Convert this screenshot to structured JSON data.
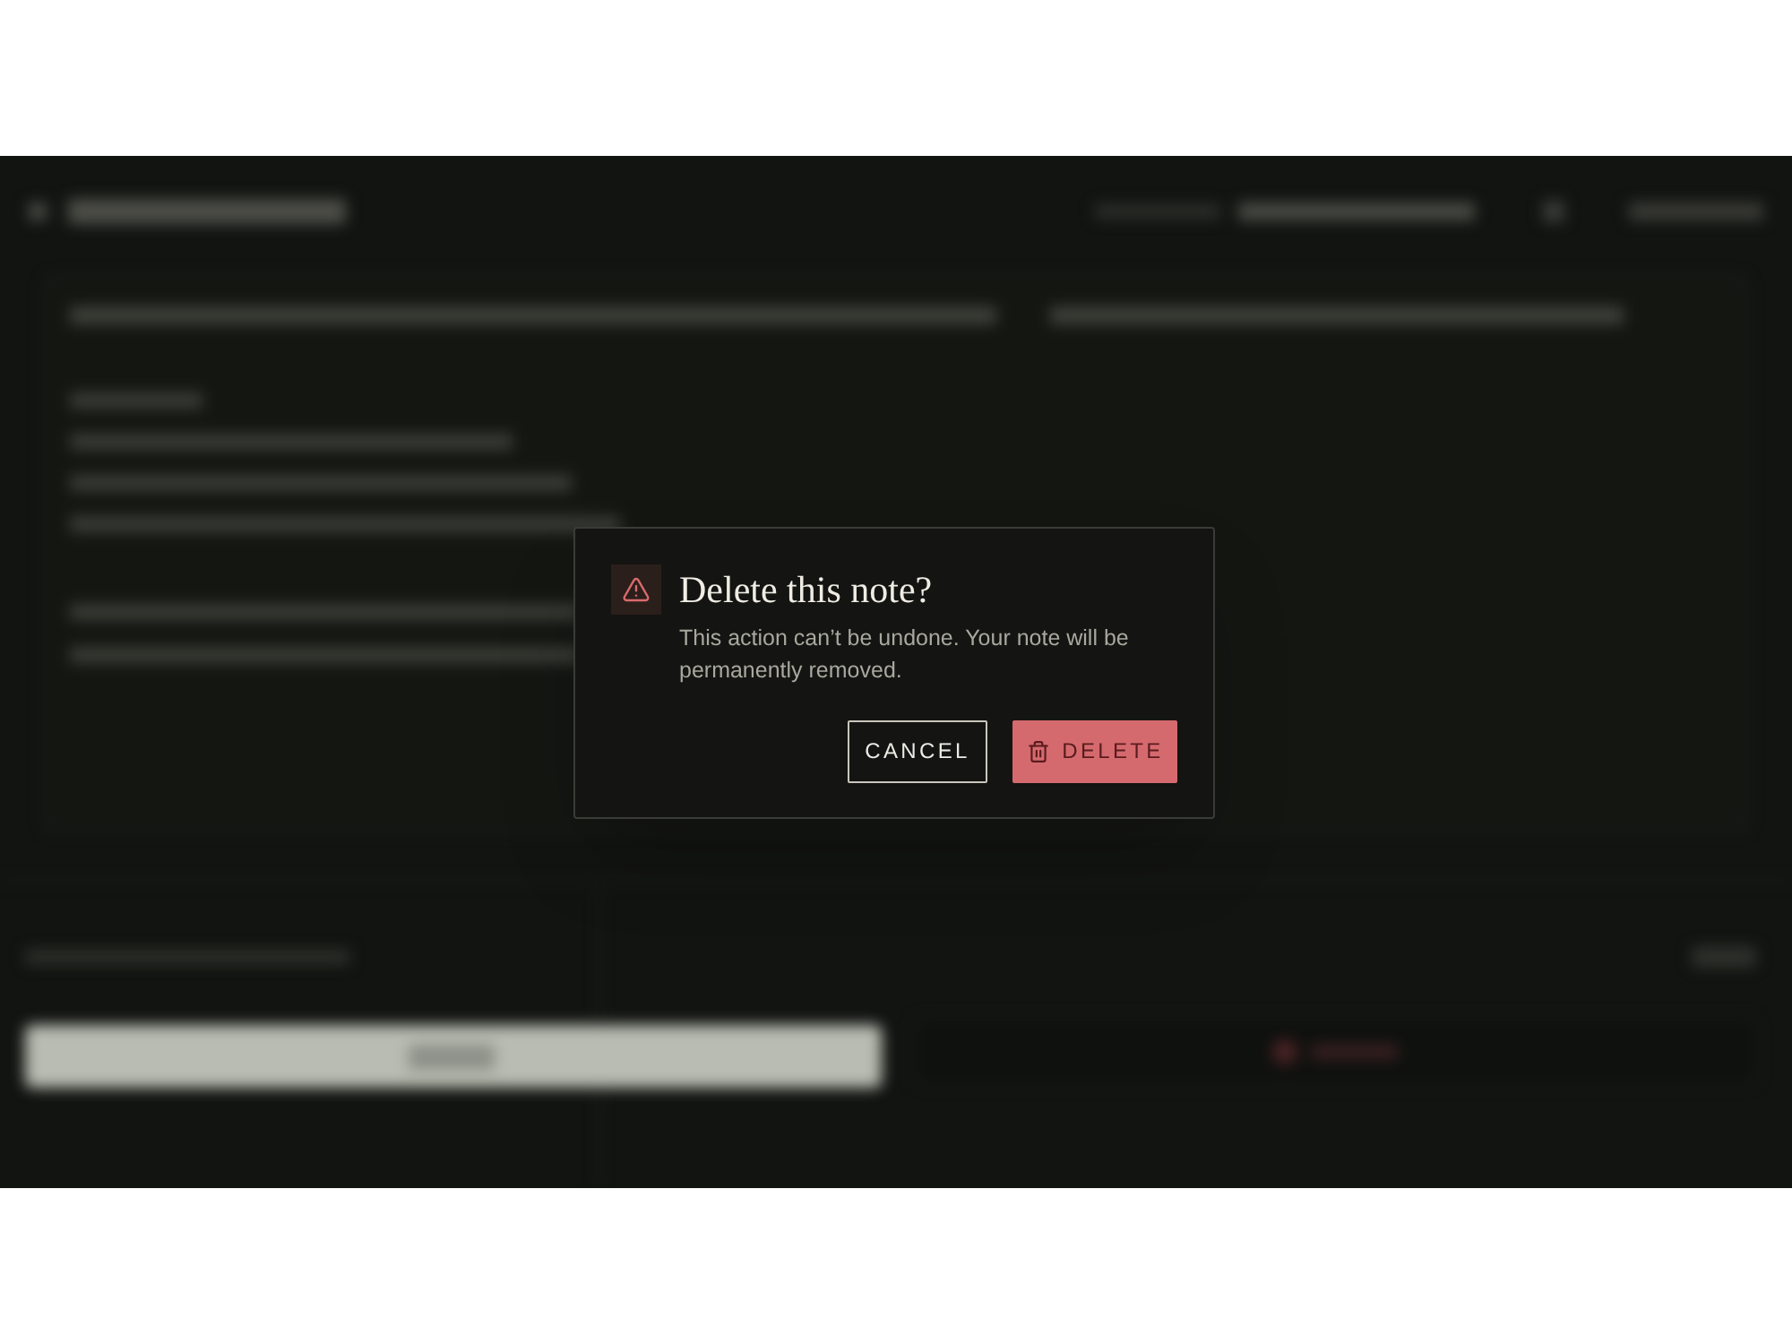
{
  "dialog": {
    "title": "Delete this note?",
    "message": "This action can’t be undone. Your note will be permanently removed.",
    "buttons": [
      {
        "label": "CANCEL",
        "kind": "secondary"
      },
      {
        "label": "DELETE",
        "kind": "danger"
      }
    ]
  }
}
